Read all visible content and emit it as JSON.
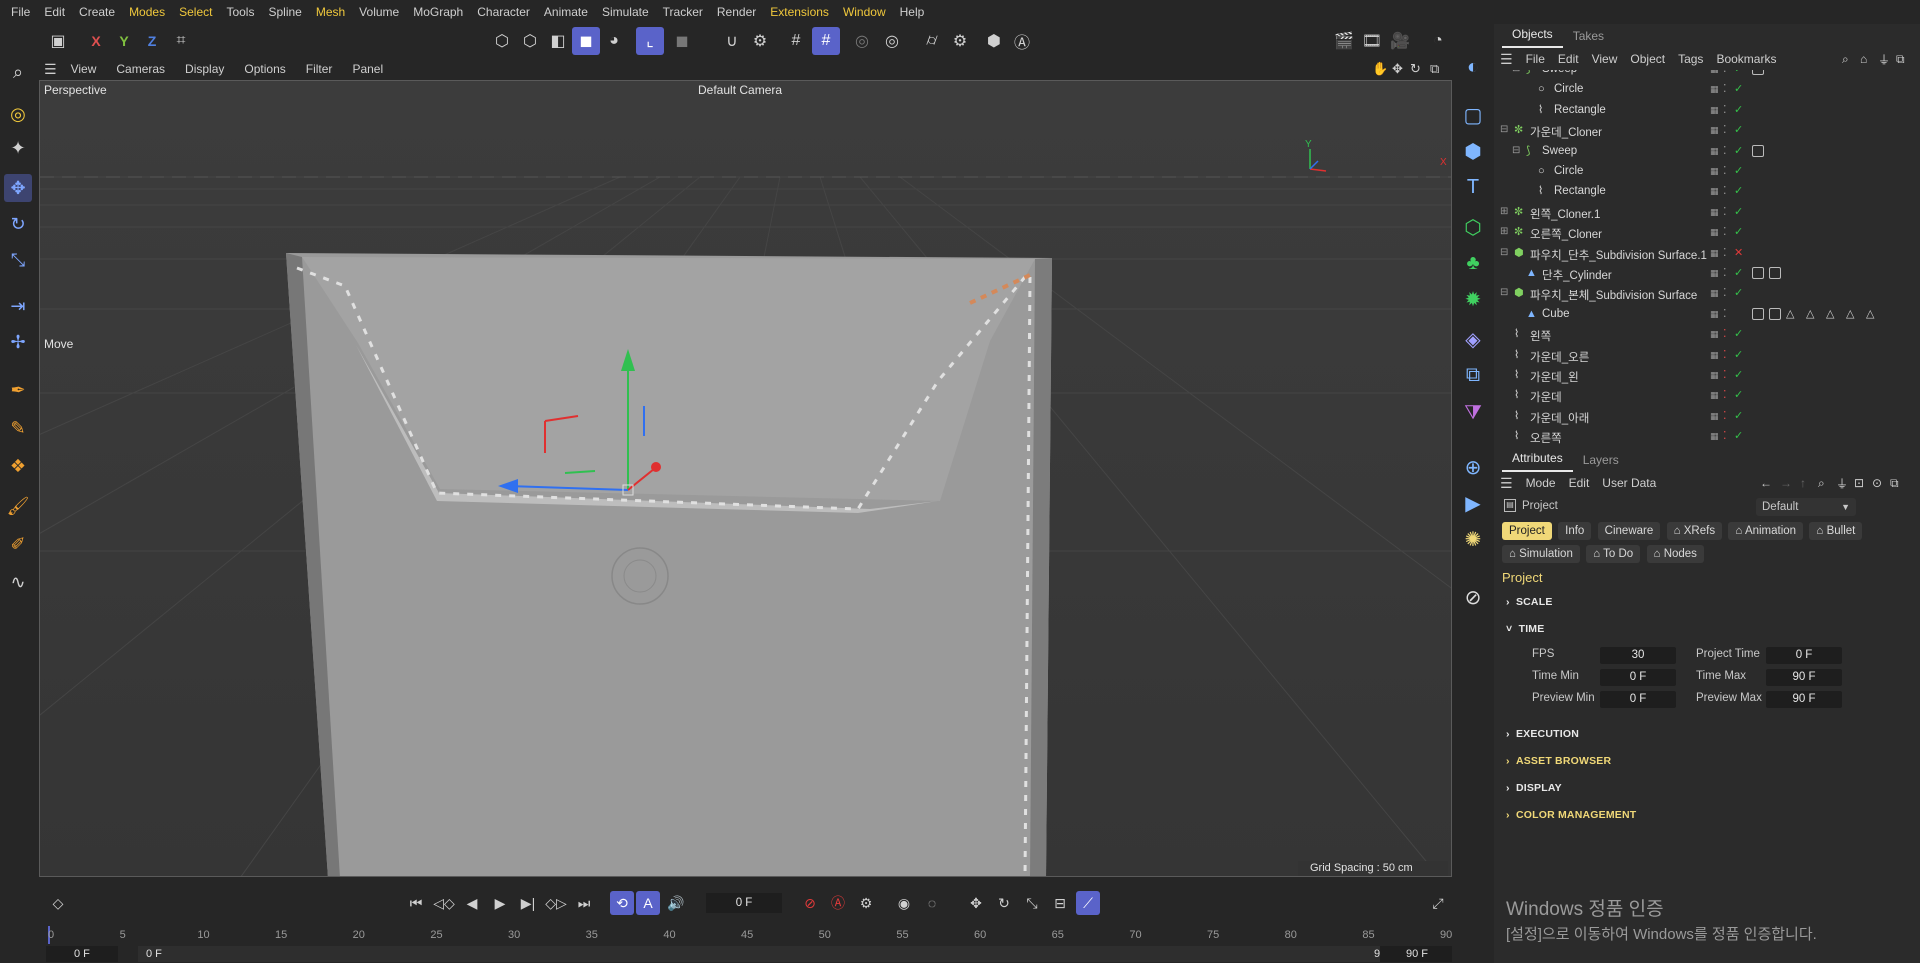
{
  "menu": [
    "File",
    "Edit",
    "Create",
    "Modes",
    "Select",
    "Tools",
    "Spline",
    "Mesh",
    "Volume",
    "MoGraph",
    "Character",
    "Animate",
    "Simulate",
    "Tracker",
    "Render",
    "Extensions",
    "Window",
    "Help"
  ],
  "toolbar": {
    "axis_x": "X",
    "axis_y": "Y",
    "axis_z": "Z"
  },
  "viewport": {
    "menu": [
      "View",
      "Cameras",
      "Display",
      "Options",
      "Filter",
      "Panel"
    ],
    "label": "Perspective",
    "camera": "Default Camera",
    "tool": "Move",
    "grid_spacing": "Grid Spacing : 50 cm",
    "axis_y": "Y",
    "axis_x": "X"
  },
  "objects": {
    "tabs": [
      "Objects",
      "Takes"
    ],
    "menu": [
      "File",
      "Edit",
      "View",
      "Object",
      "Tags",
      "Bookmarks"
    ],
    "rows": [
      {
        "name": "Sweep",
        "indent": 2,
        "icon": "sweep",
        "check": "check"
      },
      {
        "name": "Circle",
        "indent": 3,
        "icon": "circle",
        "check": "check"
      },
      {
        "name": "Rectangle",
        "indent": 3,
        "icon": "spline",
        "check": "check"
      },
      {
        "name": "가운데_Cloner",
        "indent": 1,
        "icon": "cloner",
        "check": "check"
      },
      {
        "name": "Sweep",
        "indent": 2,
        "icon": "sweep",
        "check": "check"
      },
      {
        "name": "Circle",
        "indent": 3,
        "icon": "circle",
        "check": "check"
      },
      {
        "name": "Rectangle",
        "indent": 3,
        "icon": "spline",
        "check": "check"
      },
      {
        "name": "왼쪽_Cloner.1",
        "indent": 1,
        "icon": "cloner",
        "check": "check"
      },
      {
        "name": "오른쪽_Cloner",
        "indent": 1,
        "icon": "cloner",
        "check": "check"
      },
      {
        "name": "파우치_단추_Subdivision Surface.1",
        "indent": 1,
        "icon": "subdiv",
        "check": "x"
      },
      {
        "name": "단추_Cylinder",
        "indent": 2,
        "icon": "prim",
        "check": "check"
      },
      {
        "name": "파우치_본체_Subdivision Surface",
        "indent": 1,
        "icon": "subdiv",
        "check": "check"
      },
      {
        "name": "Cube",
        "indent": 2,
        "icon": "prim",
        "check": "none"
      },
      {
        "name": "왼쪽",
        "indent": 1,
        "icon": "spline",
        "check": "check"
      },
      {
        "name": "가운데_오른",
        "indent": 1,
        "icon": "spline",
        "check": "check"
      },
      {
        "name": "가운데_왼",
        "indent": 1,
        "icon": "spline",
        "check": "check"
      },
      {
        "name": "가운데",
        "indent": 1,
        "icon": "spline",
        "check": "check"
      },
      {
        "name": "가운데_아래",
        "indent": 1,
        "icon": "spline",
        "check": "check"
      },
      {
        "name": "오른쪽",
        "indent": 1,
        "icon": "spline",
        "check": "check"
      }
    ]
  },
  "attributes": {
    "tabs": [
      "Attributes",
      "Layers"
    ],
    "menu": [
      "Mode",
      "Edit",
      "User Data"
    ],
    "object": "Project",
    "preset": "Default",
    "buttons_row1": [
      "Project",
      "Info",
      "Cineware",
      "XRefs",
      "Animation",
      "Bullet"
    ],
    "buttons_row2": [
      "Simulation",
      "To Do",
      "Nodes"
    ],
    "section_title": "Project",
    "sections": [
      "SCALE",
      "TIME",
      "EXECUTION",
      "ASSET BROWSER",
      "DISPLAY",
      "COLOR MANAGEMENT"
    ],
    "fields": {
      "fps_label": "FPS",
      "fps": "30",
      "project_time_label": "Project Time",
      "project_time": "0 F",
      "time_min_label": "Time Min",
      "time_min": "0 F",
      "time_max_label": "Time Max",
      "time_max": "90 F",
      "preview_min_label": "Preview Min",
      "preview_min": "0 F",
      "preview_max_label": "Preview Max",
      "preview_max": "90 F"
    }
  },
  "timeline": {
    "current_frame": "0 F",
    "ticks": [
      "0",
      "5",
      "10",
      "15",
      "20",
      "25",
      "30",
      "35",
      "40",
      "45",
      "50",
      "55",
      "60",
      "65",
      "70",
      "75",
      "80",
      "85",
      "90"
    ],
    "start": "0 F",
    "range_start": "0 F",
    "range_end": "90 F",
    "end": "90 F"
  },
  "watermark": {
    "line1": "Windows 정품 인증",
    "line2": "[설정]으로 이동하여 Windows를 정품 인증합니다."
  },
  "colors": {
    "accent": "#5a63c9",
    "highlight": "#f0d878",
    "check": "#34c14a"
  }
}
